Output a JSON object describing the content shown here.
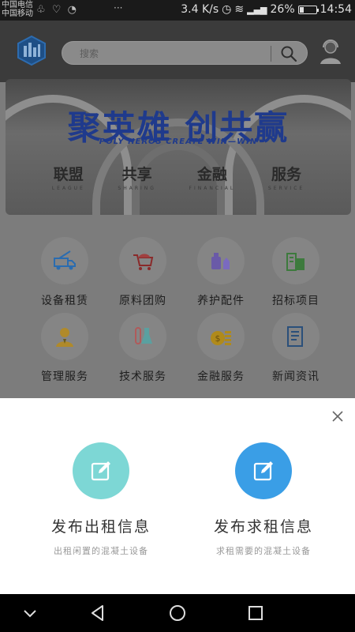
{
  "status_bar": {
    "carrier_1": "中国电信",
    "carrier_2": "中国移动",
    "more": "···",
    "net_speed": "3.4 K/s",
    "battery": "26%",
    "battery_level": 0.26,
    "time": "14:54"
  },
  "header": {
    "search_placeholder": "搜索"
  },
  "banner": {
    "title": "聚英雄  创共赢",
    "subtitle": "POLY HEROS CREATE WIN—WIN",
    "words": [
      {
        "zh": "联盟",
        "en": "LEAGUE"
      },
      {
        "zh": "共享",
        "en": "SHARING"
      },
      {
        "zh": "金融",
        "en": "FINANCIAL"
      },
      {
        "zh": "服务",
        "en": "SERVICE"
      }
    ]
  },
  "categories": [
    {
      "label": "设备租赁",
      "icon": "truck-icon"
    },
    {
      "label": "原料团购",
      "icon": "cart-icon"
    },
    {
      "label": "养护配件",
      "icon": "bottles-icon"
    },
    {
      "label": "招标项目",
      "icon": "buildings-icon"
    },
    {
      "label": "管理服务",
      "icon": "manager-icon"
    },
    {
      "label": "技术服务",
      "icon": "lab-icon"
    },
    {
      "label": "金融服务",
      "icon": "coins-icon"
    },
    {
      "label": "新闻资讯",
      "icon": "news-icon"
    }
  ],
  "sheet": {
    "options": [
      {
        "title": "发布出租信息",
        "desc": "出租闲置的混凝土设备",
        "color": "#7dd7d5"
      },
      {
        "title": "发布求租信息",
        "desc": "求租需要的混凝土设备",
        "color": "#3a9ee6"
      }
    ]
  },
  "colors": {
    "brand_blue": "#1f3a8c",
    "teal": "#7dd7d5",
    "blue": "#3a9ee6"
  }
}
